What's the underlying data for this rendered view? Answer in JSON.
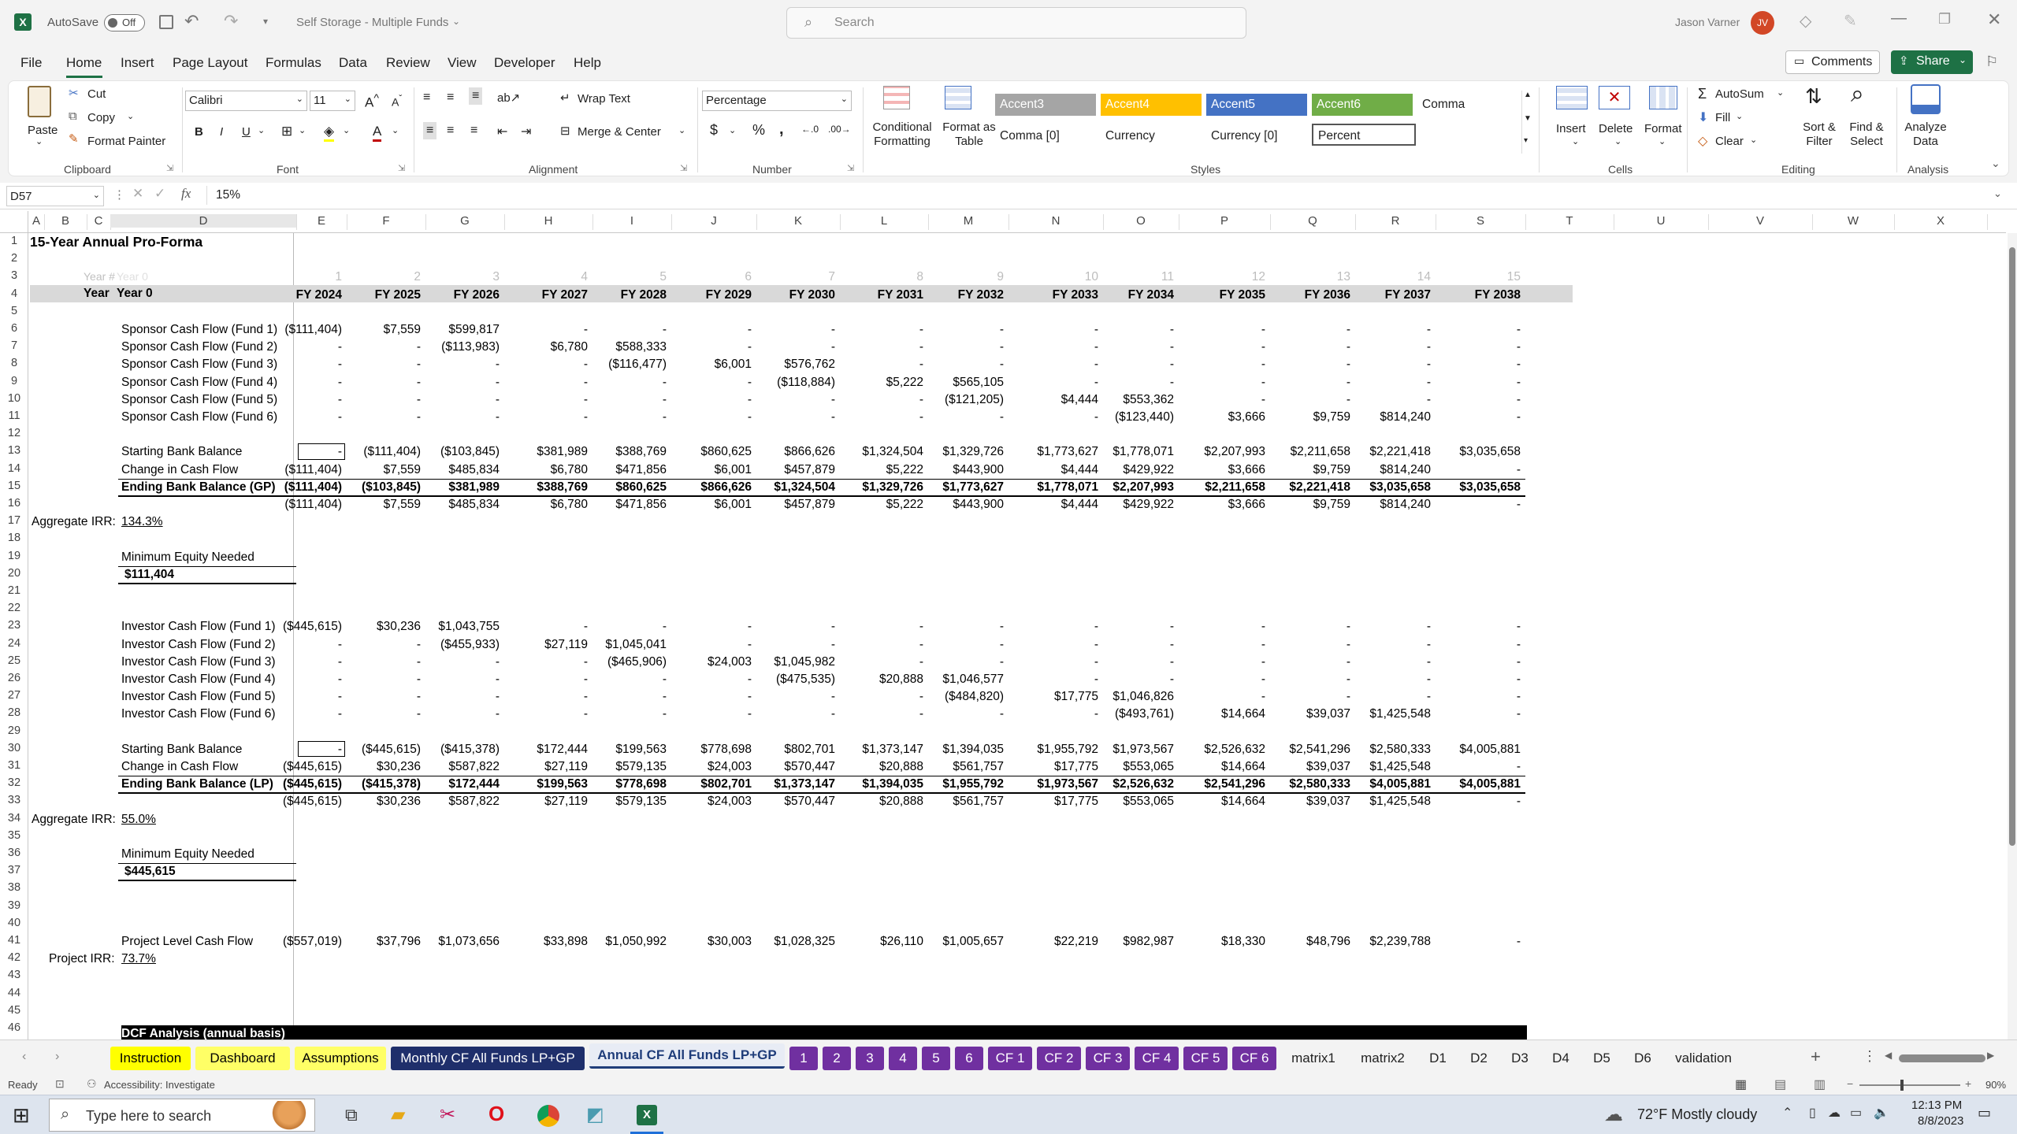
{
  "titlebar": {
    "autosave_label": "AutoSave",
    "autosave_state": "Off",
    "doc_title": "Self Storage - Multiple Funds",
    "search_placeholder": "Search",
    "user_name": "Jason Varner",
    "user_initials": "JV"
  },
  "menu": [
    "File",
    "Home",
    "Insert",
    "Page Layout",
    "Formulas",
    "Data",
    "Review",
    "View",
    "Developer",
    "Help"
  ],
  "menu_right": {
    "comments": "Comments",
    "share": "Share"
  },
  "ribbon": {
    "clipboard": {
      "paste": "Paste",
      "cut": "Cut",
      "copy": "Copy",
      "format_painter": "Format Painter",
      "group": "Clipboard"
    },
    "font": {
      "name": "Calibri",
      "size": "11",
      "group": "Font"
    },
    "alignment": {
      "wrap": "Wrap Text",
      "merge": "Merge & Center",
      "group": "Alignment"
    },
    "number": {
      "format": "Percentage",
      "group": "Number"
    },
    "styles": {
      "cond_fmt": "Conditional Formatting",
      "fmt_table": "Format as Table",
      "accent3": "Accent3",
      "accent4": "Accent4",
      "accent5": "Accent5",
      "accent6": "Accent6",
      "comma": "Comma",
      "comma0": "Comma [0]",
      "currency": "Currency",
      "currency0": "Currency [0]",
      "percent": "Percent",
      "group": "Styles"
    },
    "cells": {
      "insert": "Insert",
      "delete": "Delete",
      "format": "Format",
      "group": "Cells"
    },
    "editing": {
      "autosum": "AutoSum",
      "fill": "Fill",
      "clear": "Clear",
      "sort": "Sort & Filter",
      "find": "Find & Select",
      "group": "Editing"
    },
    "analysis": {
      "analyze": "Analyze Data",
      "group": "Analysis"
    }
  },
  "formula": {
    "namebox": "D57",
    "value": "15%"
  },
  "columns": [
    "A",
    "B",
    "C",
    "D",
    "E",
    "F",
    "G",
    "H",
    "I",
    "J",
    "K",
    "L",
    "M",
    "N",
    "O",
    "P",
    "Q",
    "R",
    "S",
    "T",
    "U",
    "V",
    "W",
    "X"
  ],
  "rows": [
    "1",
    "2",
    "3",
    "4",
    "5",
    "6",
    "7",
    "8",
    "9",
    "10",
    "11",
    "12",
    "13",
    "14",
    "15",
    "16",
    "17",
    "18",
    "19",
    "20",
    "21",
    "22",
    "23",
    "24",
    "25",
    "26",
    "27",
    "28",
    "29",
    "30",
    "31",
    "32",
    "33",
    "34",
    "35",
    "36",
    "37",
    "38",
    "39",
    "40",
    "41",
    "42",
    "43",
    "44",
    "45",
    "46"
  ],
  "sheet": {
    "title": "15-Year Annual Pro-Forma",
    "r3_labels": [
      "Year #",
      "Year 0"
    ],
    "r3_vals": [
      "1",
      "2",
      "3",
      "4",
      "5",
      "6",
      "7",
      "8",
      "9",
      "10",
      "11",
      "12",
      "13",
      "14",
      "15"
    ],
    "r4_labels": [
      "Year",
      "Year 0"
    ],
    "fy": [
      "FY 2024",
      "FY 2025",
      "FY 2026",
      "FY 2027",
      "FY 2028",
      "FY 2029",
      "FY 2030",
      "FY 2031",
      "FY 2032",
      "FY 2033",
      "FY 2034",
      "FY 2035",
      "FY 2036",
      "FY 2037",
      "FY 2038"
    ],
    "sponsor": [
      {
        "label": "Sponsor Cash Flow (Fund 1)",
        "v": [
          "($111,404)",
          "$7,559",
          "$599,817",
          "-",
          "-",
          "-",
          "-",
          "-",
          "-",
          "-",
          "-",
          "-",
          "-",
          "-",
          "-"
        ]
      },
      {
        "label": "Sponsor Cash Flow (Fund 2)",
        "v": [
          "-",
          "-",
          "($113,983)",
          "$6,780",
          "$588,333",
          "-",
          "-",
          "-",
          "-",
          "-",
          "-",
          "-",
          "-",
          "-",
          "-"
        ]
      },
      {
        "label": "Sponsor Cash Flow (Fund 3)",
        "v": [
          "-",
          "-",
          "-",
          "-",
          "($116,477)",
          "$6,001",
          "$576,762",
          "-",
          "-",
          "-",
          "-",
          "-",
          "-",
          "-",
          "-"
        ]
      },
      {
        "label": "Sponsor Cash Flow (Fund 4)",
        "v": [
          "-",
          "-",
          "-",
          "-",
          "-",
          "-",
          "($118,884)",
          "$5,222",
          "$565,105",
          "-",
          "-",
          "-",
          "-",
          "-",
          "-"
        ]
      },
      {
        "label": "Sponsor Cash Flow (Fund 5)",
        "v": [
          "-",
          "-",
          "-",
          "-",
          "-",
          "-",
          "-",
          "-",
          "($121,205)",
          "$4,444",
          "$553,362",
          "-",
          "-",
          "-",
          "-"
        ]
      },
      {
        "label": "Sponsor Cash Flow (Fund 6)",
        "v": [
          "-",
          "-",
          "-",
          "-",
          "-",
          "-",
          "-",
          "-",
          "-",
          "-",
          "($123,440)",
          "$3,666",
          "$9,759",
          "$814,240",
          "-"
        ]
      }
    ],
    "gp_start": {
      "label": "Starting Bank Balance",
      "v": [
        "-",
        "($111,404)",
        "($103,845)",
        "$381,989",
        "$388,769",
        "$860,625",
        "$866,626",
        "$1,324,504",
        "$1,329,726",
        "$1,773,627",
        "$1,778,071",
        "$2,207,993",
        "$2,211,658",
        "$2,221,418",
        "$3,035,658"
      ]
    },
    "gp_change": {
      "label": "Change in Cash Flow",
      "v": [
        "($111,404)",
        "$7,559",
        "$485,834",
        "$6,780",
        "$471,856",
        "$6,001",
        "$457,879",
        "$5,222",
        "$443,900",
        "$4,444",
        "$429,922",
        "$3,666",
        "$9,759",
        "$814,240",
        "-"
      ]
    },
    "gp_end": {
      "label": "Ending Bank Balance (GP)",
      "v": [
        "($111,404)",
        "($103,845)",
        "$381,989",
        "$388,769",
        "$860,625",
        "$866,626",
        "$1,324,504",
        "$1,329,726",
        "$1,773,627",
        "$1,778,071",
        "$2,207,993",
        "$2,211,658",
        "$2,221,418",
        "$3,035,658",
        "$3,035,658"
      ]
    },
    "gp_r16": [
      "($111,404)",
      "$7,559",
      "$485,834",
      "$6,780",
      "$471,856",
      "$6,001",
      "$457,879",
      "$5,222",
      "$443,900",
      "$4,444",
      "$429,922",
      "$3,666",
      "$9,759",
      "$814,240",
      "-"
    ],
    "gp_irr_label": "Aggregate IRR:",
    "gp_irr": "134.3%",
    "gp_min_label": "Minimum Equity Needed",
    "gp_min": "$111,404",
    "investor": [
      {
        "label": "Investor Cash Flow (Fund 1)",
        "v": [
          "($445,615)",
          "$30,236",
          "$1,043,755",
          "-",
          "-",
          "-",
          "-",
          "-",
          "-",
          "-",
          "-",
          "-",
          "-",
          "-",
          "-"
        ]
      },
      {
        "label": "Investor Cash Flow (Fund 2)",
        "v": [
          "-",
          "-",
          "($455,933)",
          "$27,119",
          "$1,045,041",
          "-",
          "-",
          "-",
          "-",
          "-",
          "-",
          "-",
          "-",
          "-",
          "-"
        ]
      },
      {
        "label": "Investor Cash Flow (Fund 3)",
        "v": [
          "-",
          "-",
          "-",
          "-",
          "($465,906)",
          "$24,003",
          "$1,045,982",
          "-",
          "-",
          "-",
          "-",
          "-",
          "-",
          "-",
          "-"
        ]
      },
      {
        "label": "Investor Cash Flow (Fund 4)",
        "v": [
          "-",
          "-",
          "-",
          "-",
          "-",
          "-",
          "($475,535)",
          "$20,888",
          "$1,046,577",
          "-",
          "-",
          "-",
          "-",
          "-",
          "-"
        ]
      },
      {
        "label": "Investor Cash Flow (Fund 5)",
        "v": [
          "-",
          "-",
          "-",
          "-",
          "-",
          "-",
          "-",
          "-",
          "($484,820)",
          "$17,775",
          "$1,046,826",
          "-",
          "-",
          "-",
          "-"
        ]
      },
      {
        "label": "Investor Cash Flow (Fund 6)",
        "v": [
          "-",
          "-",
          "-",
          "-",
          "-",
          "-",
          "-",
          "-",
          "-",
          "-",
          "($493,761)",
          "$14,664",
          "$39,037",
          "$1,425,548",
          "-"
        ]
      }
    ],
    "lp_start": {
      "label": "Starting Bank Balance",
      "v": [
        "-",
        "($445,615)",
        "($415,378)",
        "$172,444",
        "$199,563",
        "$778,698",
        "$802,701",
        "$1,373,147",
        "$1,394,035",
        "$1,955,792",
        "$1,973,567",
        "$2,526,632",
        "$2,541,296",
        "$2,580,333",
        "$4,005,881"
      ]
    },
    "lp_change": {
      "label": "Change in Cash Flow",
      "v": [
        "($445,615)",
        "$30,236",
        "$587,822",
        "$27,119",
        "$579,135",
        "$24,003",
        "$570,447",
        "$20,888",
        "$561,757",
        "$17,775",
        "$553,065",
        "$14,664",
        "$39,037",
        "$1,425,548",
        "-"
      ]
    },
    "lp_end": {
      "label": "Ending Bank Balance (LP)",
      "v": [
        "($445,615)",
        "($415,378)",
        "$172,444",
        "$199,563",
        "$778,698",
        "$802,701",
        "$1,373,147",
        "$1,394,035",
        "$1,955,792",
        "$1,973,567",
        "$2,526,632",
        "$2,541,296",
        "$2,580,333",
        "$4,005,881",
        "$4,005,881"
      ]
    },
    "lp_r33": [
      "($445,615)",
      "$30,236",
      "$587,822",
      "$27,119",
      "$579,135",
      "$24,003",
      "$570,447",
      "$20,888",
      "$561,757",
      "$17,775",
      "$553,065",
      "$14,664",
      "$39,037",
      "$1,425,548",
      "-"
    ],
    "lp_irr_label": "Aggregate IRR:",
    "lp_irr": "55.0%",
    "lp_min_label": "Minimum Equity Needed",
    "lp_min": "$445,615",
    "project": {
      "label": "Project Level Cash Flow",
      "v": [
        "($557,019)",
        "$37,796",
        "$1,073,656",
        "$33,898",
        "$1,050,992",
        "$30,003",
        "$1,028,325",
        "$26,110",
        "$1,005,657",
        "$22,219",
        "$982,987",
        "$18,330",
        "$48,796",
        "$2,239,788",
        "-"
      ]
    },
    "proj_irr_label": "Project IRR:",
    "proj_irr": "73.7%",
    "r46_text": "DCF Analysis (annual basis)"
  },
  "tabs": [
    {
      "name": "Instruction",
      "bg": "#ffff00",
      "fg": "#000"
    },
    {
      "name": "Dashboard",
      "bg": "#ffff66",
      "fg": "#000"
    },
    {
      "name": "Assumptions",
      "bg": "#ffff66",
      "fg": "#000"
    },
    {
      "name": "Monthly CF All Funds LP+GP",
      "bg": "#1f2f6b",
      "fg": "#fff"
    },
    {
      "name": "Annual CF All Funds LP+GP",
      "bg": "#e8ecf5",
      "fg": "#1f3d7a"
    },
    {
      "name": "1",
      "bg": "#7030a0",
      "fg": "#fff"
    },
    {
      "name": "2",
      "bg": "#7030a0",
      "fg": "#fff"
    },
    {
      "name": "3",
      "bg": "#7030a0",
      "fg": "#fff"
    },
    {
      "name": "4",
      "bg": "#7030a0",
      "fg": "#fff"
    },
    {
      "name": "5",
      "bg": "#7030a0",
      "fg": "#fff"
    },
    {
      "name": "6",
      "bg": "#7030a0",
      "fg": "#fff"
    },
    {
      "name": "CF 1",
      "bg": "#7030a0",
      "fg": "#fff"
    },
    {
      "name": "CF 2",
      "bg": "#7030a0",
      "fg": "#fff"
    },
    {
      "name": "CF 3",
      "bg": "#7030a0",
      "fg": "#fff"
    },
    {
      "name": "CF 4",
      "bg": "#7030a0",
      "fg": "#fff"
    },
    {
      "name": "CF 5",
      "bg": "#7030a0",
      "fg": "#fff"
    },
    {
      "name": "CF 6",
      "bg": "#7030a0",
      "fg": "#fff"
    },
    {
      "name": "matrix1",
      "bg": "transparent",
      "fg": "#222"
    },
    {
      "name": "matrix2",
      "bg": "transparent",
      "fg": "#222"
    },
    {
      "name": "D1",
      "bg": "transparent",
      "fg": "#222"
    },
    {
      "name": "D2",
      "bg": "transparent",
      "fg": "#222"
    },
    {
      "name": "D3",
      "bg": "transparent",
      "fg": "#222"
    },
    {
      "name": "D4",
      "bg": "transparent",
      "fg": "#222"
    },
    {
      "name": "D5",
      "bg": "transparent",
      "fg": "#222"
    },
    {
      "name": "D6",
      "bg": "transparent",
      "fg": "#222"
    },
    {
      "name": "validation",
      "bg": "transparent",
      "fg": "#222"
    }
  ],
  "status": {
    "ready": "Ready",
    "accessibility": "Accessibility: Investigate",
    "zoom": "90%"
  },
  "taskbar": {
    "search_placeholder": "Type here to search",
    "weather": "72°F  Mostly cloudy",
    "time": "12:13 PM",
    "date": "8/8/2023"
  },
  "colors": {
    "excel_green": "#1e7145",
    "accent3": "#a5a5a5",
    "accent4": "#ffc000",
    "accent5": "#4472c4",
    "accent6": "#70ad47"
  }
}
